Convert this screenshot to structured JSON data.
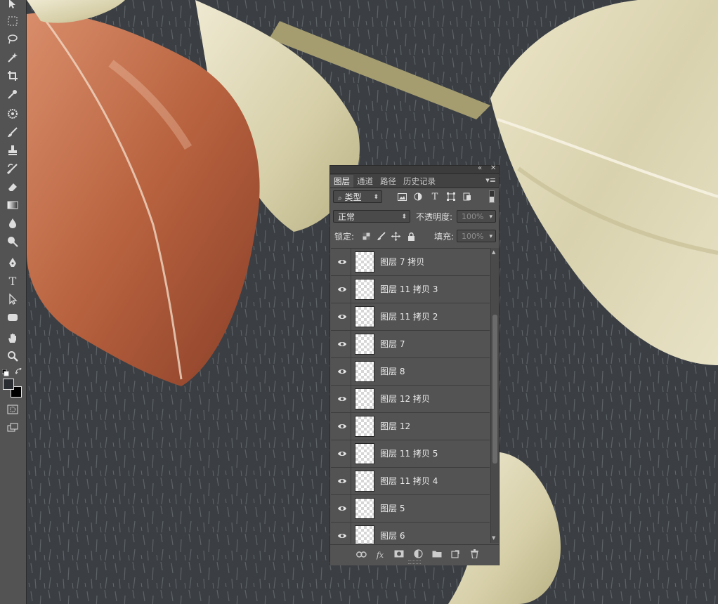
{
  "toolbar": {
    "tools": [
      {
        "name": "move-tool",
        "icon": "move-icon"
      },
      {
        "name": "marquee-tool",
        "icon": "rect-select-icon"
      },
      {
        "name": "lasso-tool",
        "icon": "lasso-icon"
      },
      {
        "name": "magic-wand-tool",
        "icon": "wand-icon"
      },
      {
        "name": "crop-tool",
        "icon": "crop-icon"
      },
      {
        "name": "eyedropper-tool",
        "icon": "eyedropper-icon"
      },
      {
        "name": "healing-tool",
        "icon": "healing-icon"
      },
      {
        "name": "brush-tool",
        "icon": "brush-icon"
      },
      {
        "name": "stamp-tool",
        "icon": "stamp-icon"
      },
      {
        "name": "history-brush-tool",
        "icon": "history-brush-icon"
      },
      {
        "name": "eraser-tool",
        "icon": "eraser-icon"
      },
      {
        "name": "gradient-tool",
        "icon": "gradient-icon"
      },
      {
        "name": "blur-tool",
        "icon": "drop-icon"
      },
      {
        "name": "dodge-tool",
        "icon": "dodge-icon"
      },
      {
        "name": "pen-tool",
        "icon": "pen-icon"
      },
      {
        "name": "type-tool",
        "icon": "type-icon",
        "label": "T"
      },
      {
        "name": "path-select-tool",
        "icon": "arrow-icon"
      },
      {
        "name": "shape-tool",
        "icon": "rounded-rect-icon"
      },
      {
        "name": "hand-tool",
        "icon": "hand-icon"
      },
      {
        "name": "zoom-tool",
        "icon": "zoom-icon"
      }
    ],
    "foreground_color": "#2a2d31",
    "background_color": "#000000"
  },
  "panel": {
    "tabs": [
      {
        "label": "图层",
        "active": true
      },
      {
        "label": "通道",
        "active": false
      },
      {
        "label": "路径",
        "active": false
      },
      {
        "label": "历史记录",
        "active": false
      }
    ],
    "filter_label": "类型",
    "blend_mode": "正常",
    "opacity_label": "不透明度:",
    "opacity_value": "100%",
    "lock_label": "锁定:",
    "fill_label": "填充:",
    "fill_value": "100%",
    "layers": [
      {
        "name": "图层 7 拷贝",
        "visible": true
      },
      {
        "name": "图层 11 拷贝 3",
        "visible": true
      },
      {
        "name": "图层 11 拷贝 2",
        "visible": true
      },
      {
        "name": "图层 7",
        "visible": true
      },
      {
        "name": "图层 8",
        "visible": true
      },
      {
        "name": "图层 12 拷贝",
        "visible": true
      },
      {
        "name": "图层 12",
        "visible": true
      },
      {
        "name": "图层 11 拷贝 5",
        "visible": true
      },
      {
        "name": "图层 11 拷贝 4",
        "visible": true
      },
      {
        "name": "图层 5",
        "visible": true
      },
      {
        "name": "图层 6",
        "visible": true
      }
    ],
    "footer_buttons": [
      "link-icon",
      "fx-icon",
      "mask-icon",
      "adjustment-icon",
      "folder-icon",
      "new-layer-icon",
      "trash-icon"
    ],
    "colors": {
      "panel_bg": "#535353",
      "canvas_bg": "#3b3f44",
      "leaf_red": "#b8623f",
      "leaf_cream": "#d9d2b0"
    }
  }
}
